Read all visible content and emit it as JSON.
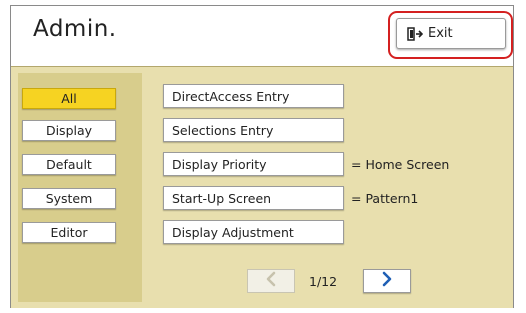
{
  "header": {
    "title": "Admin.",
    "exit_label": "Exit"
  },
  "categories": [
    {
      "label": "All",
      "active": true
    },
    {
      "label": "Display",
      "active": false
    },
    {
      "label": "Default",
      "active": false
    },
    {
      "label": "System",
      "active": false
    },
    {
      "label": "Editor",
      "active": false
    }
  ],
  "items": [
    {
      "label": "DirectAccess Entry",
      "value": ""
    },
    {
      "label": "Selections Entry",
      "value": ""
    },
    {
      "label": "Display Priority",
      "value": "= Home Screen"
    },
    {
      "label": "Start-Up Screen",
      "value": "= Pattern1"
    },
    {
      "label": "Display Adjustment",
      "value": ""
    }
  ],
  "pager": {
    "indicator": "1/12",
    "prev_icon": "chevron-left-icon",
    "next_icon": "chevron-right-icon",
    "prev_enabled": false,
    "next_enabled": true
  },
  "colors": {
    "highlight": "#d42020",
    "active_category": "#f6d322",
    "panel_background": "#e8dfae",
    "category_column": "#d8cd8c",
    "chevron_active": "#1f5fb5",
    "chevron_disabled": "#c7c2ad"
  }
}
